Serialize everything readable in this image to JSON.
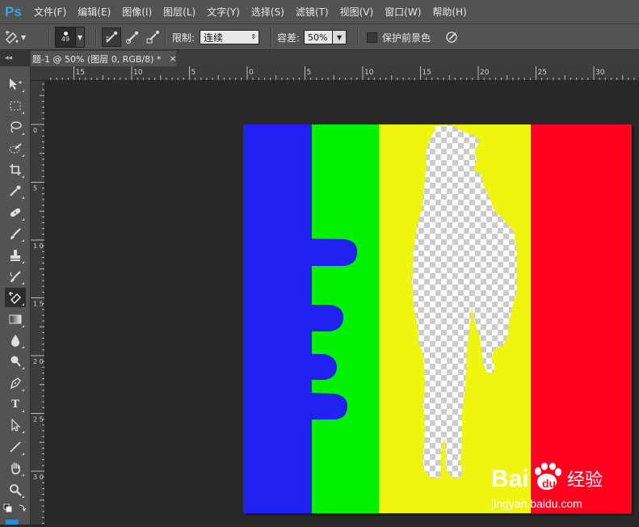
{
  "app": {
    "logo_text": "Ps"
  },
  "menu": {
    "items": [
      "文件(F)",
      "编辑(E)",
      "图像(I)",
      "图层(L)",
      "文字(Y)",
      "选择(S)",
      "滤镜(T)",
      "视图(V)",
      "窗口(W)",
      "帮助(H)"
    ]
  },
  "options": {
    "brush_size": "49",
    "limit_label": "限制:",
    "limit_value": "连续",
    "tolerance_label": "容差:",
    "tolerance_value": "50%",
    "protect_label": "保护前景色"
  },
  "tab": {
    "title": "题-1 @ 50% (图层 0, RGB/8) *",
    "close": "×"
  },
  "panel_collapse": "◂◂",
  "ruler": {
    "h_labels": [
      "15",
      "10",
      "5",
      "0",
      "5",
      "10",
      "15",
      "20",
      "25",
      "30"
    ],
    "v_labels": [
      "0",
      "5",
      "1 0",
      "1 5",
      "2 0",
      "2 5",
      "3 0"
    ]
  },
  "toolbox": {
    "type_tool_label": "T",
    "tools": [
      "move-tool",
      "marquee-tool",
      "lasso-tool",
      "quick-selection-tool",
      "crop-tool",
      "eyedropper-tool",
      "healing-brush-tool",
      "brush-tool",
      "clone-stamp-tool",
      "history-brush-tool",
      "background-eraser-tool",
      "gradient-tool",
      "blur-tool",
      "dodge-tool",
      "pen-tool",
      "type-tool",
      "path-selection-tool",
      "line-tool",
      "hand-tool",
      "zoom-tool"
    ],
    "active_tool": "background-eraser-tool",
    "foreground_color": "#1e8fe0"
  },
  "image": {
    "stripe_colors": [
      "#2222f0",
      "#00f000",
      "#eef510",
      "#ff0020"
    ]
  },
  "watermark": {
    "brand_left": "Bai",
    "brand_right": "du",
    "suffix": "经验",
    "url": "jingyan.baidu.com"
  }
}
